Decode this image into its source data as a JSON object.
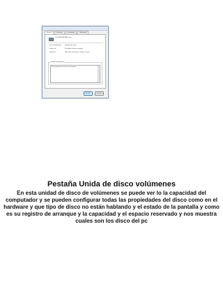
{
  "dialog": {
    "tabs": [
      "General",
      "Hardware",
      "Controlador",
      "Volúmenes"
    ],
    "active_tab_index": 0,
    "drive_name": "ST3320813AS ATA Device",
    "properties": [
      {
        "label": "Tipo de dispositivo:",
        "value": "Unidades de disco"
      },
      {
        "label": "Fabricante:",
        "value": "(Unidades de disco estándar)"
      },
      {
        "label": "Ubicación:",
        "value": "Ubicación 0 (Channel 0, Target 0, Lun 0)"
      }
    ],
    "status_title": "Estado del dispositivo",
    "status_text": "Este dispositivo funciona correctamente.",
    "buttons": {
      "ok": "Aceptar",
      "cancel": "Cancelar"
    }
  },
  "heading": "Pestaña Unida de disco volúmenes",
  "body": "En esta unidad de disco de volúmenes se puede ver lo la capacidad del computador y se pueden configurar todas las propiedades del disco como en el hardware y que tipo de disco no están hablando y el estado de la pantalla y como es su registro de arranque y la capacidad y el espacio reservado y nos muestra cuales son los disco del pc"
}
